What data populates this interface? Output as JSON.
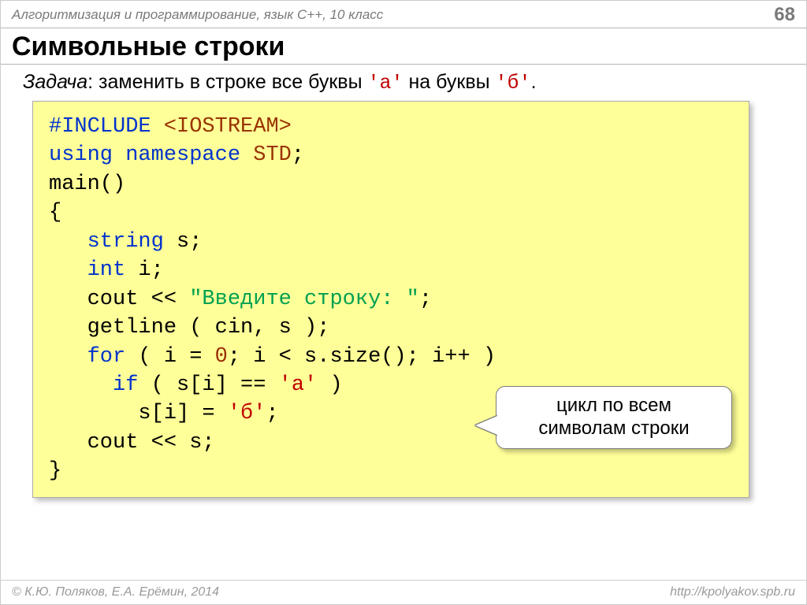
{
  "header": {
    "subject": "Алгоритмизация и программирование, язык C++, 10 класс",
    "page_number": "68"
  },
  "title": "Символьные строки",
  "task": {
    "label": "Задача",
    "text_before": ": заменить в строке все буквы ",
    "lit_a": "'а'",
    "text_mid": " на буквы ",
    "lit_b": "'б'",
    "text_after": "."
  },
  "code": {
    "l1a": "#INCLUDE ",
    "l1b": "<IOSTREAM>",
    "l2a": "using namespace ",
    "l2b": "STD",
    "l2c": ";",
    "l3": "main()",
    "l4": "{",
    "l5a": "   string",
    "l5b": " s;",
    "l6a": "   int",
    "l6b": " i;",
    "l7a": "   cout << ",
    "l7b": "\"Введите строку: \"",
    "l7c": ";",
    "l8": "   getline ( cin, s );",
    "l9a": "   for",
    "l9b": " ( i = ",
    "l9c": "0",
    "l9d": "; i < s.size(); i++ )",
    "l10a": "     if",
    "l10b": " ( s[i] == ",
    "l10c": "'а'",
    "l10d": " )",
    "l11a": "       s[i] = ",
    "l11b": "'б'",
    "l11c": ";",
    "l12": "   cout << s;",
    "l13": "}"
  },
  "callout": {
    "line1": "цикл по всем",
    "line2": "символам строки"
  },
  "footer": {
    "left": "© К.Ю. Поляков, Е.А. Ерёмин, 2014",
    "right": "http://kpolyakov.spb.ru"
  }
}
